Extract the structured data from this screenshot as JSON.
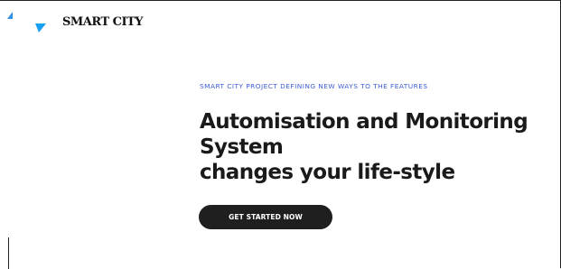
{
  "brand": {
    "name": "SMART CITY",
    "logo_colors": [
      "#2f8ee6",
      "#1aa0f0"
    ]
  },
  "hero": {
    "eyebrow": "SMART CITY PROJECT DEFINING NEW WAYS TO THE FEATURES",
    "headline_lines": [
      "Automisation and Monitoring",
      "System",
      "changes your life-style"
    ],
    "cta_label": "GET STARTED NOW"
  },
  "colors": {
    "accent": "#3d5dd6",
    "button_bg": "#1f1f1f",
    "text": "#1a1a1a"
  }
}
